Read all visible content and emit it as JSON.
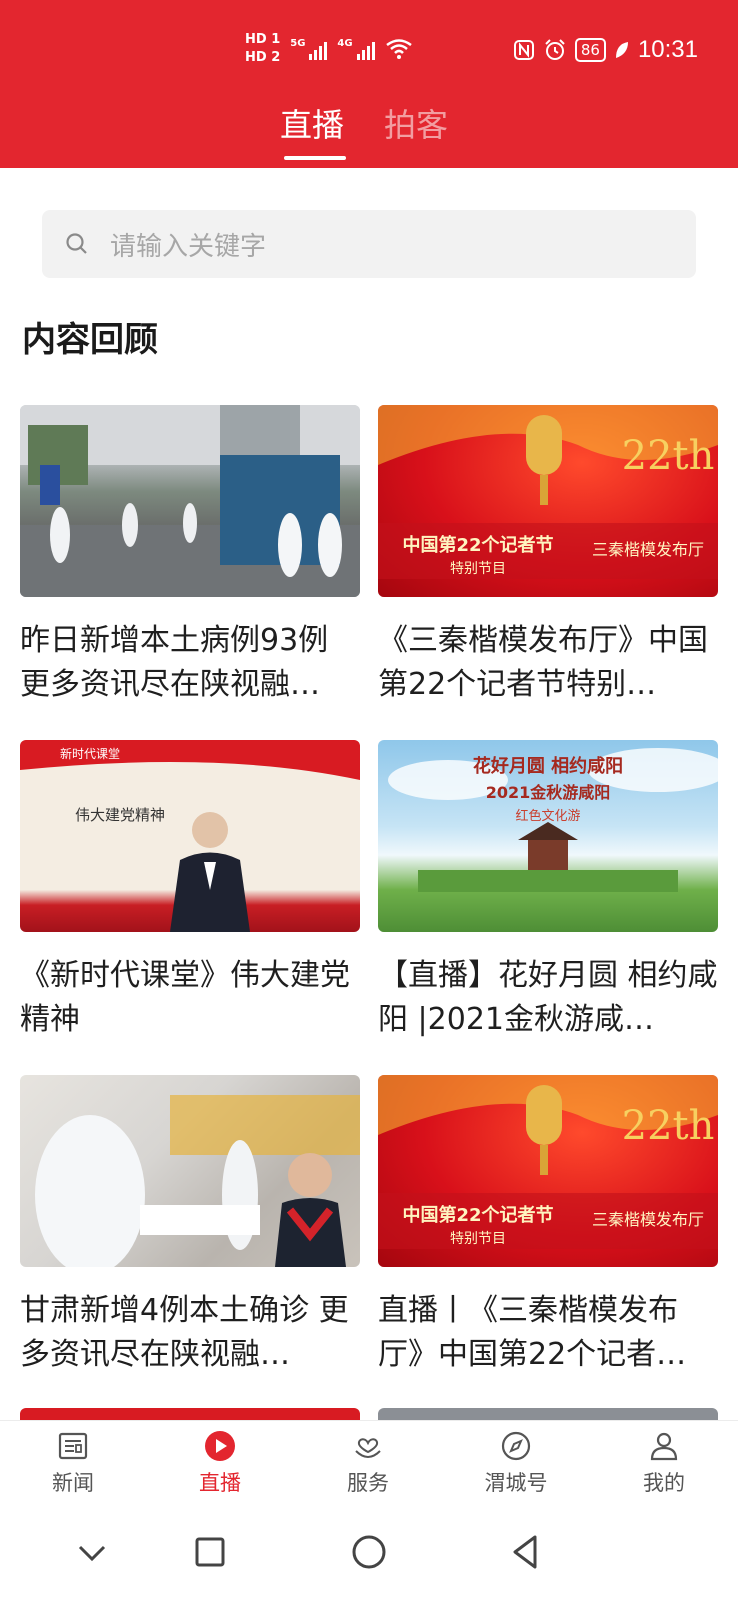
{
  "status_bar": {
    "hd1": "HD 1",
    "hd2": "HD 2",
    "net1": "5G",
    "net2": "4G",
    "battery": "86",
    "time": "10:31"
  },
  "tabs": [
    {
      "label": "直播",
      "active": true
    },
    {
      "label": "拍客",
      "active": false
    }
  ],
  "search": {
    "placeholder": "请输入关键字",
    "icon": "search-icon"
  },
  "section_title": "内容回顾",
  "cards": [
    {
      "title": "昨日新增本土病例93例 更多资讯尽在陕视融…",
      "thumb": "street-checkpoint"
    },
    {
      "title": "《三秦楷模发布厅》中国第22个记者节特别…",
      "thumb": "journalist-festival",
      "overlay_main": "中国第22个记者节",
      "overlay_sub": "特别节目",
      "overlay_right": "三秦楷模发布厅",
      "badge": "22th"
    },
    {
      "title": "《新时代课堂》伟大建党精神",
      "thumb": "new-era-classroom",
      "overlay_main": "伟大建党精神",
      "overlay_top": "新时代课堂"
    },
    {
      "title": "【直播】花好月圆 相约咸阳 |2021金秋游咸…",
      "thumb": "xianyang-tour",
      "overlay_main": "花好月圆  相约咸阳",
      "overlay_sub": "2021金秋游咸阳",
      "overlay_sub2": "红色文化游"
    },
    {
      "title": "甘肃新增4例本土确诊 更多资讯尽在陕视融…",
      "thumb": "testing-site"
    },
    {
      "title": "直播丨《三秦楷模发布厅》中国第22个记者…",
      "thumb": "journalist-festival",
      "overlay_main": "中国第22个记者节",
      "overlay_sub": "特别节目",
      "overlay_right": "三秦楷模发布厅",
      "badge": "22th"
    }
  ],
  "bottom_nav": [
    {
      "label": "新闻",
      "icon": "news-icon",
      "active": false
    },
    {
      "label": "直播",
      "icon": "live-play-icon",
      "active": true
    },
    {
      "label": "服务",
      "icon": "service-heart-icon",
      "active": false
    },
    {
      "label": "渭城号",
      "icon": "compass-icon",
      "active": false
    },
    {
      "label": "我的",
      "icon": "user-icon",
      "active": false
    }
  ],
  "colors": {
    "brand_red": "#e3262f",
    "text_dark": "#1f1f1f",
    "placeholder": "#a7a7a7",
    "nav_inactive": "#555555"
  }
}
